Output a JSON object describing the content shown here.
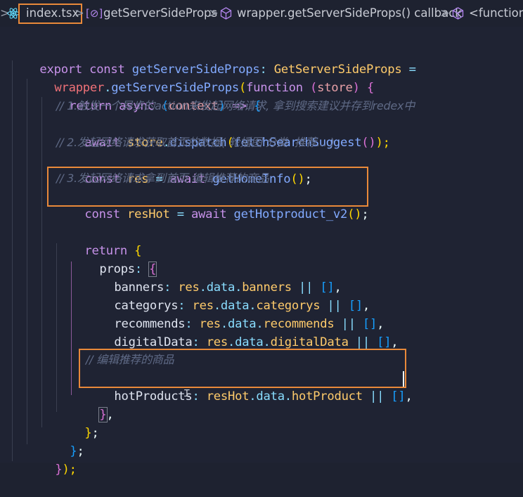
{
  "breadcrumb": {
    "file": "index.tsx",
    "func1": "getServerSideProps",
    "func2": "wrapper.getServerSideProps() callback",
    "func3": "<function>",
    "separator": ">"
  },
  "code": {
    "l1": {
      "a": "export",
      "b": "const",
      "c": "getServerSideProps",
      "d": ":",
      "e": "GetServerSideProps",
      "f": "="
    },
    "l2": {
      "a": "wrapper",
      "b": ".",
      "c": "getServerSideProps",
      "d": "(",
      "e": "function",
      "f": "(",
      "g": "store",
      "h": ")",
      "i": "{"
    },
    "l3": {
      "a": "return",
      "b": "async",
      "c": "(",
      "d": "context",
      "e": ")",
      "f": "=>",
      "g": "{"
    },
    "l4": "// 1.触发一个异步的action来发起网络请求, 拿到搜索建议并存到redex中",
    "l5": {
      "a": "await",
      "b": "store",
      "c": ".",
      "d": "dispatch",
      "e": "(",
      "f": "fetchSearchSuggest",
      "g": "()",
      "h": ");"
    },
    "l6": "// 2.发起网络请求获取首页的数据( 轮播图 分类  推荐... )",
    "l7": {
      "a": "const",
      "b": "res",
      "c": "=",
      "d": "await",
      "e": "getHomeInfo",
      "f": "()",
      "g": ";"
    },
    "l8": "// 3.发起网络请求拿到首页 编辑推荐的商品",
    "l9": {
      "a": "const",
      "b": "resHot",
      "c": "=",
      "d": "await",
      "e": "getHotproduct_v2",
      "f": "()",
      "g": ";"
    },
    "l11": {
      "a": "return",
      "b": "{"
    },
    "l12": {
      "a": "props",
      ":": ":",
      "b": "{"
    },
    "l13": {
      "a": "banners",
      "b": ":",
      "c": "res",
      "d": ".data.",
      "e": "banners",
      "f": "||",
      "g": "[]",
      "h": ","
    },
    "l14": {
      "a": "categorys",
      "b": ":",
      "c": "res",
      "d": ".data.",
      "e": "categorys",
      "f": "||",
      "g": "[]",
      "h": ","
    },
    "l15": {
      "a": "recommends",
      "b": ":",
      "c": "res",
      "d": ".data.",
      "e": "recommends",
      "f": "||",
      "g": "[]",
      "h": ","
    },
    "l16": {
      "a": "digitalData",
      "b": ":",
      "c": "res",
      "d": ".data.",
      "e": "digitalData",
      "f": "||",
      "g": "[]",
      "h": ","
    },
    "l18": "// 编辑推荐的商品",
    "l19": {
      "a": "hotProducts",
      "b": ":",
      "c": "resHot",
      "d": ".data.",
      "e": "hotProduct",
      "f": "||",
      "g": "[]",
      "h": ","
    },
    "l20": {
      "a": "}",
      "b": ","
    },
    "l21": {
      "a": "}",
      "b": ";"
    },
    "l22": {
      "a": "}",
      "b": ";"
    },
    "l23": {
      "a": "}",
      "b": ");"
    }
  },
  "colors": {
    "background": "#1f2333",
    "highlight_box": "#e9893a",
    "keyword": "#c792ea",
    "function": "#82aaff",
    "type": "#ffcb6b",
    "comment": "#5f6a86"
  }
}
